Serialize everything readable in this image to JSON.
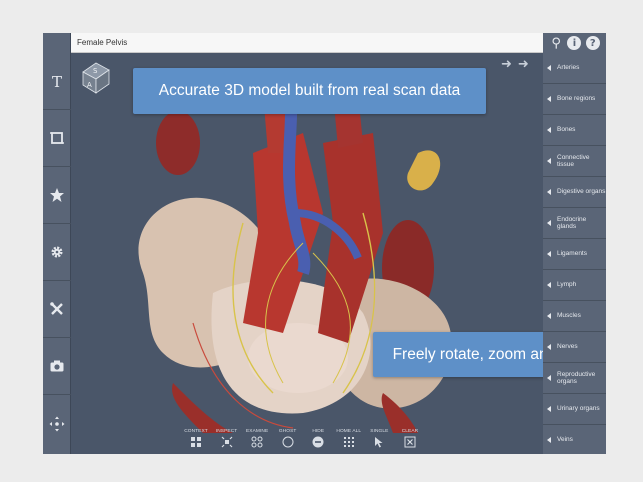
{
  "title_bar": {
    "title": "Female Pelvis"
  },
  "top_icons": [
    "search-icon",
    "info-icon",
    "help-icon"
  ],
  "left_toolbar": [
    "text-icon",
    "crop-icon",
    "star-icon",
    "gear-icon",
    "tools-icon",
    "camera-icon",
    "move-icon"
  ],
  "orientation_cube": {
    "faces": [
      "S",
      "A"
    ]
  },
  "callouts": {
    "top": "Accurate 3D model built from real scan data",
    "bottom": "Freely rotate, zoom and pan"
  },
  "right_menu": [
    {
      "label": "Arteries"
    },
    {
      "label": "Bone regions"
    },
    {
      "label": "Bones"
    },
    {
      "label": "Connective tissue"
    },
    {
      "label": "Digestive organs"
    },
    {
      "label": "Endocrine glands"
    },
    {
      "label": "Ligaments"
    },
    {
      "label": "Lymph"
    },
    {
      "label": "Muscles"
    },
    {
      "label": "Nerves"
    },
    {
      "label": "Reproductive organs"
    },
    {
      "label": "Urinary organs"
    },
    {
      "label": "Veins"
    }
  ],
  "bottom_toolbar": [
    {
      "label": "CONTEXT",
      "icon": "context-icon"
    },
    {
      "label": "INSPECT",
      "icon": "inspect-icon"
    },
    {
      "label": "EXAMINE",
      "icon": "examine-icon"
    },
    {
      "label": "GHOST",
      "icon": "ghost-icon"
    },
    {
      "label": "HIDE",
      "icon": "hide-icon"
    },
    {
      "label": "HOME ALL",
      "icon": "home-all-icon"
    },
    {
      "label": "SINGLE",
      "icon": "single-icon"
    },
    {
      "label": "CLEAR",
      "icon": "clear-icon"
    }
  ],
  "colors": {
    "accent": "#5e90c8",
    "panel": "#5a6577",
    "viewport": "#4a5669"
  }
}
